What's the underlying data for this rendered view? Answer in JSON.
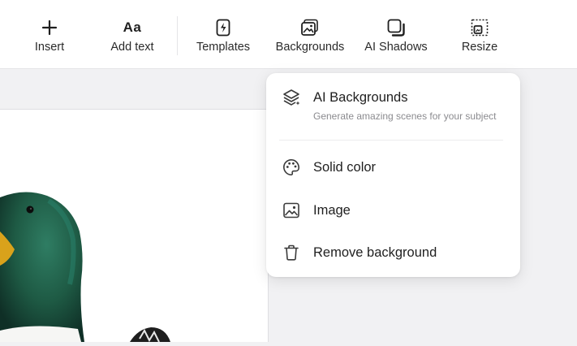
{
  "toolbar": {
    "insert": "Insert",
    "add_text_glyph": "Aa",
    "add_text": "Add text",
    "templates": "Templates",
    "backgrounds": "Backgrounds",
    "ai_shadows": "AI Shadows",
    "resize": "Resize"
  },
  "menu": {
    "ai_backgrounds": {
      "label": "AI Backgrounds",
      "subtitle": "Generate amazing scenes for your subject",
      "icon": "layers-sparkle-icon"
    },
    "solid_color": {
      "label": "Solid color",
      "icon": "palette-icon"
    },
    "image": {
      "label": "Image",
      "icon": "image-icon"
    },
    "remove_background": {
      "label": "Remove background",
      "icon": "trash-icon"
    }
  },
  "colors": {
    "icon": "#3a3a3a",
    "subtitle": "#8b8b8f",
    "canvas": "#f1f1f3",
    "duck_head": "#1f5b45"
  }
}
